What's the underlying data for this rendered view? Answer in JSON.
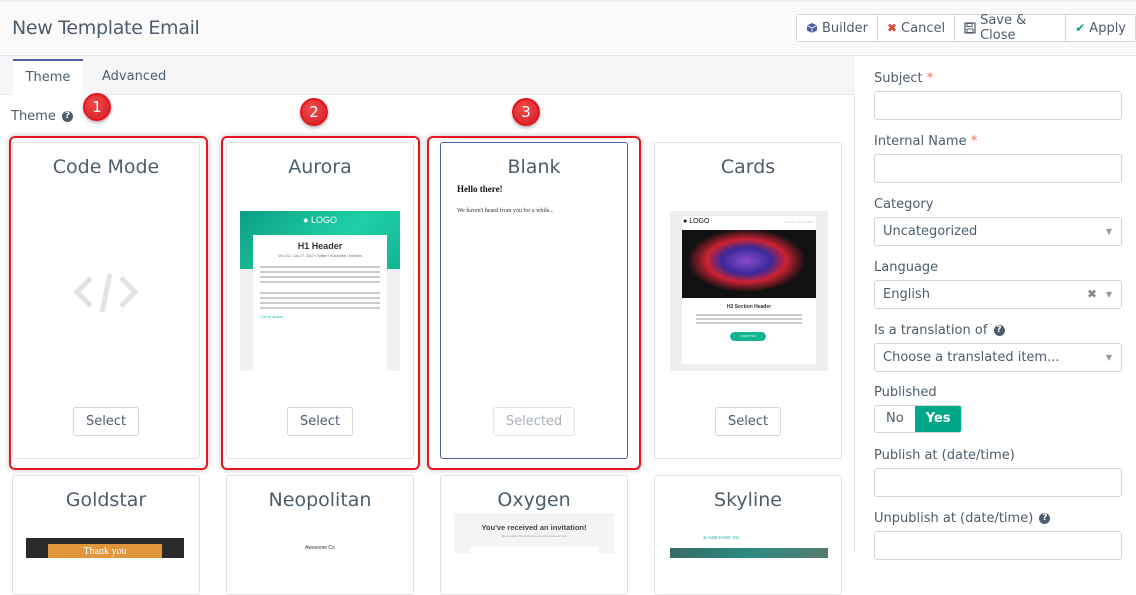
{
  "header": {
    "title": "New Template Email",
    "buttons": [
      {
        "label": "Builder",
        "icon": "cube-icon"
      },
      {
        "label": "Cancel",
        "icon": "close-icon"
      },
      {
        "label": "Save & Close",
        "icon": "save-icon"
      },
      {
        "label": "Apply",
        "icon": "check-icon"
      }
    ]
  },
  "tabs": [
    {
      "label": "Theme",
      "active": true
    },
    {
      "label": "Advanced",
      "active": false
    }
  ],
  "theme_section": {
    "label": "Theme",
    "help": "?"
  },
  "annotations": [
    "1",
    "2",
    "3"
  ],
  "themes": [
    {
      "name": "Code Mode",
      "button": "Select",
      "selected": false,
      "preview": "code-icon"
    },
    {
      "name": "Aurora",
      "button": "Select",
      "selected": false,
      "preview_text": {
        "logo": "LOGO",
        "header": "H1 Header",
        "meta": "Vol 2.11 • Oct 27, 2017 • Twitter / Subscribe / Archives",
        "cta": "Call to Action"
      }
    },
    {
      "name": "Blank",
      "button": "Selected",
      "selected": true,
      "preview_text": {
        "heading": "Hello there!",
        "body": "We haven't heard from you for a while..."
      }
    },
    {
      "name": "Cards",
      "button": "Select",
      "selected": false,
      "preview_text": {
        "logo": "LOGO",
        "meta": "Vol 1.11 • Oct 27, 2017",
        "header": "H2 Section Header",
        "cta": "CTA BUTTON"
      }
    },
    {
      "name": "Goldstar",
      "preview_text": {
        "banner": "Thank you"
      }
    },
    {
      "name": "Neopolitan",
      "preview_text": {
        "company": "Awesome Co"
      }
    },
    {
      "name": "Oxygen",
      "preview_text": {
        "heading": "You've received an invitation!",
        "sub": "@username has invited you to join Awesome Inc!"
      }
    },
    {
      "name": "Skyline",
      "preview_text": {
        "logo": "AWESOME INC"
      }
    }
  ],
  "sidebar": {
    "subject": {
      "label": "Subject",
      "required": "*",
      "value": ""
    },
    "internal_name": {
      "label": "Internal Name",
      "required": "*",
      "value": ""
    },
    "category": {
      "label": "Category",
      "value": "Uncategorized"
    },
    "language": {
      "label": "Language",
      "value": "English",
      "clear": "✖"
    },
    "translation": {
      "label": "Is a translation of",
      "placeholder": "Choose a translated item..."
    },
    "published": {
      "label": "Published",
      "options": [
        "No",
        "Yes"
      ],
      "value": "Yes"
    },
    "publish_at": {
      "label": "Publish at (date/time)",
      "value": ""
    },
    "unpublish_at": {
      "label": "Unpublish at (date/time)",
      "value": ""
    }
  },
  "colors": {
    "accent": "#00a88a",
    "highlight": "#e8141e",
    "tab_active": "#4e5d9d"
  }
}
